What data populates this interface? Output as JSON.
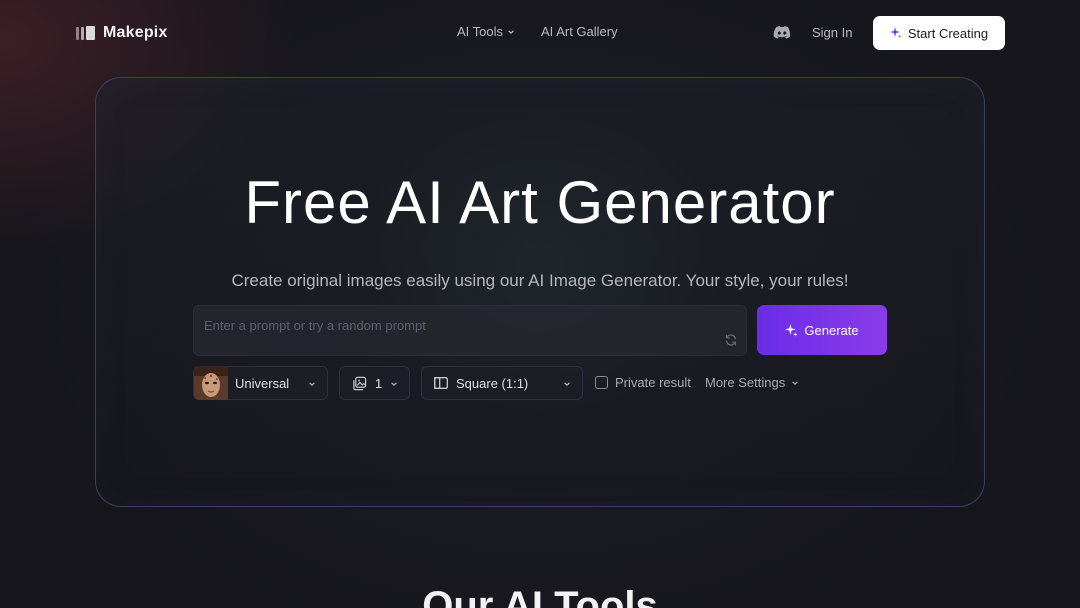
{
  "header": {
    "brand": "Makepix",
    "nav": [
      {
        "label": "AI Tools",
        "has_dropdown": true
      },
      {
        "label": "AI Art Gallery",
        "has_dropdown": false
      }
    ],
    "discord_icon": "discord-icon",
    "sign_in_label": "Sign In",
    "start_creating_label": "Start Creating"
  },
  "hero": {
    "title": "Free AI Art Generator",
    "subtitle": "Create original images easily using our AI Image Generator. Your style, your rules!",
    "prompt_placeholder": "Enter a prompt or try a random prompt",
    "prompt_value": "",
    "generate_label": "Generate"
  },
  "controls": {
    "model_label": "Universal",
    "count_value": "1",
    "ratio_label": "Square (1:1)",
    "private_label": "Private result",
    "private_checked": false,
    "more_settings_label": "More Settings"
  },
  "sections": {
    "tools_title": "Our AI Tools"
  },
  "colors": {
    "background": "#16161c",
    "accent": "#7b35e8",
    "card_border": "#3a4060"
  }
}
